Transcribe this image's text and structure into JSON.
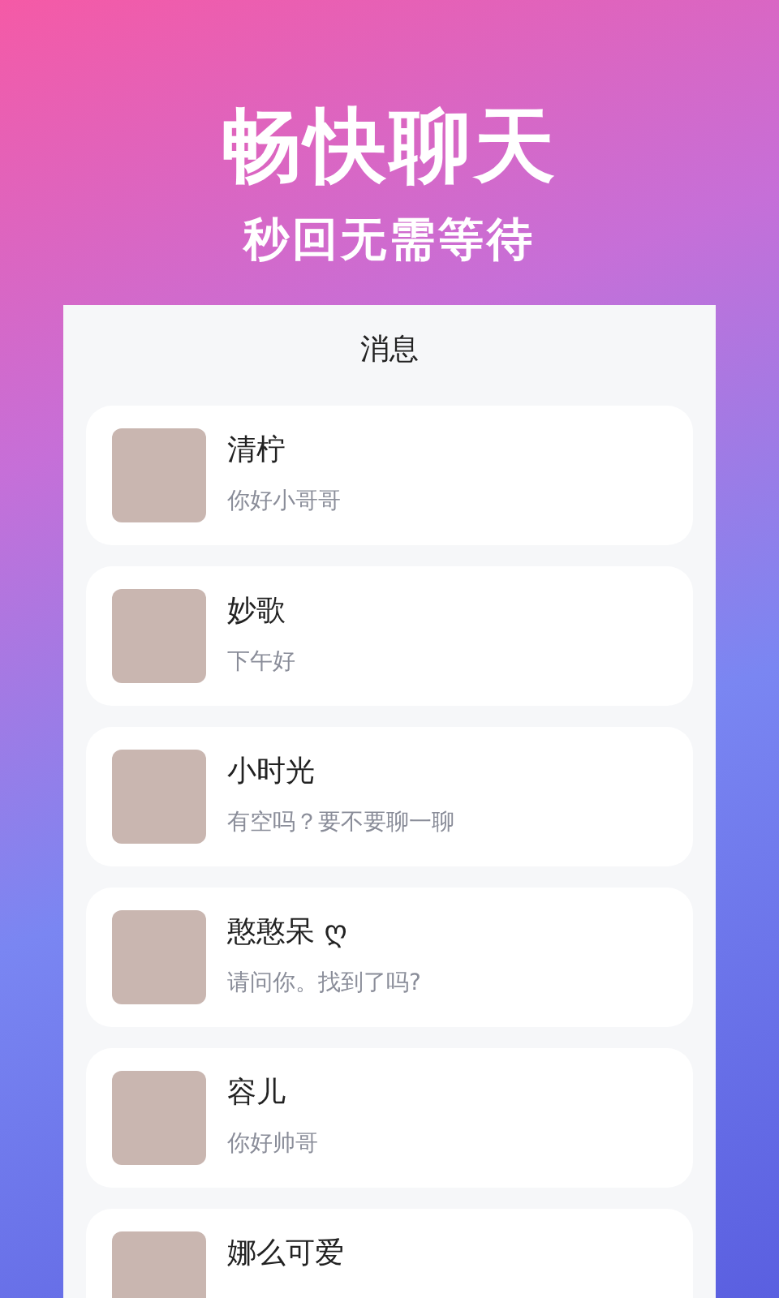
{
  "headline": "畅快聊天",
  "subheadline": "秒回无需等待",
  "screen": {
    "title": "消息",
    "chats": [
      {
        "name": "清柠",
        "message": "你好小哥哥"
      },
      {
        "name": "妙歌",
        "message": "下午好"
      },
      {
        "name": "小时光",
        "message": "有空吗？要不要聊一聊"
      },
      {
        "name": "憨憨呆 ღ",
        "message": "请问你。找到了吗?"
      },
      {
        "name": "容儿",
        "message": "你好帅哥"
      },
      {
        "name": "娜么可爱"
      }
    ]
  }
}
